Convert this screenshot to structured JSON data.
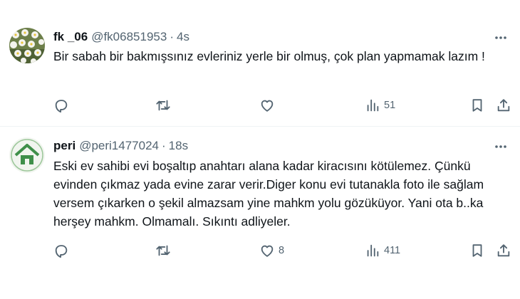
{
  "tweets": [
    {
      "name": "fk _06",
      "handle": "@fk06851953",
      "separator": "·",
      "time": "4s",
      "text": "Bir sabah bir bakmışsınız evleriniz yerle bir olmuş, çok plan yapmamak lazım !",
      "replies": "",
      "retweets": "",
      "likes": "",
      "views": "51",
      "avatar_icon": "daisy-flowers-photo"
    },
    {
      "name": "peri",
      "handle": "@peri1477024",
      "separator": "·",
      "time": "18s",
      "text": "Eski ev sahibi evi boşaltıp anahtarı alana kadar kiracısını kötülemez. Çünkü evinden çıkmaz yada evine zarar verir.Diger konu evi tutanakla foto ile sağlam versem çıkarken o şekil almazsam yine mahkm yolu gözüküyor. Yani ota b..ka herşey mahkm. Olmamalı. Sıkıntı adliyeler.",
      "replies": "",
      "retweets": "",
      "likes": "8",
      "views": "411",
      "avatar_icon": "green-house-logo"
    }
  ],
  "colors": {
    "text": "#0f1419",
    "secondary": "#536471",
    "divider": "#eff3f4"
  }
}
